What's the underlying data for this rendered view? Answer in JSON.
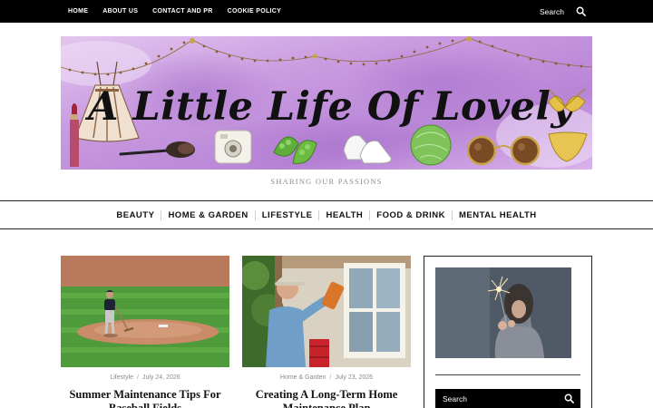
{
  "topbar": {
    "nav": [
      "HOME",
      "ABOUT US",
      "CONTACT AND PR",
      "COOKIE POLICY"
    ],
    "search_label": "Search",
    "search_icon": "search-icon"
  },
  "header": {
    "site_title": "A Little Life Of Lovely",
    "tagline": "SHARING OUR PASSIONS"
  },
  "main_nav": [
    "BEAUTY",
    "HOME & GARDEN",
    "LIFESTYLE",
    "HEALTH",
    "FOOD & DRINK",
    "MENTAL HEALTH"
  ],
  "posts": [
    {
      "category": "Lifestyle",
      "date": "July 24, 2026",
      "title": "Summer Maintenance Tips For Baseball Fields"
    },
    {
      "category": "Home & Garden",
      "date": "July 23, 2026",
      "title": "Creating A Long-Term Home Maintenance Plan"
    }
  ],
  "sidebar": {
    "search_label": "Search",
    "search_icon": "search-icon"
  },
  "colors": {
    "topbar_bg": "#000000",
    "banner_purple": "#c08fd8",
    "tagline_gray": "#8b8b8b",
    "meta_gray": "#8a8a8a"
  }
}
